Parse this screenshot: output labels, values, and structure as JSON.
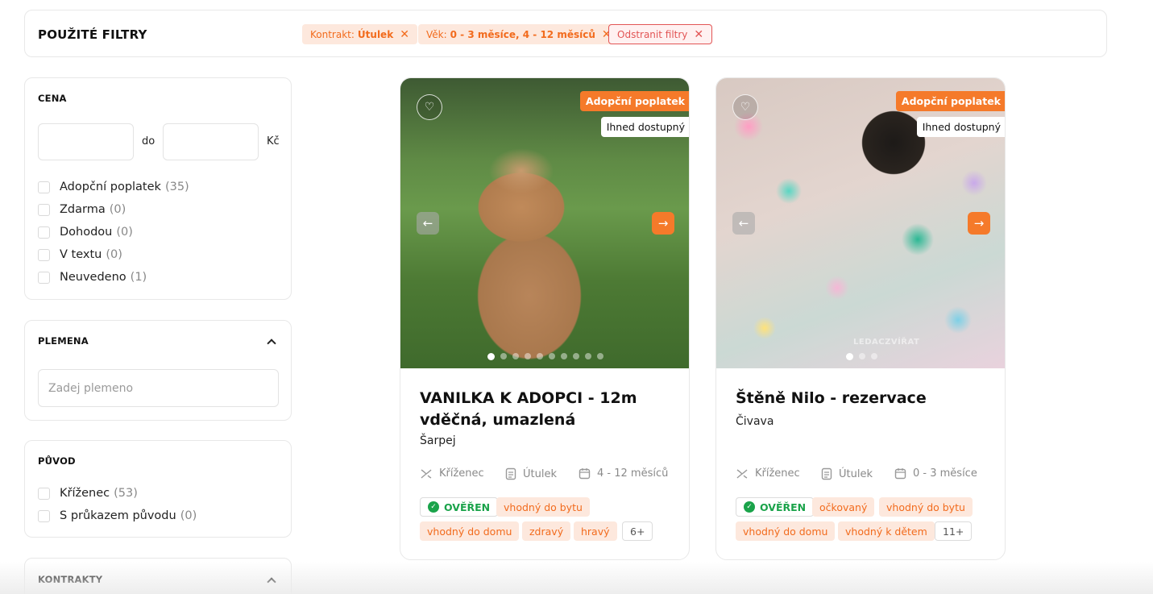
{
  "filters": {
    "title": "POUŽITÉ FILTRY",
    "chips": [
      {
        "label": "Kontrakt:",
        "value": "Útulek"
      },
      {
        "label": "Věk:",
        "value": "0 - 3 měsíce, 4 - 12 měsíců"
      }
    ],
    "clear_label": "Odstranit filtry"
  },
  "sidebar": {
    "price": {
      "title": "CENA",
      "separator": "do",
      "currency": "Kč",
      "options": [
        {
          "label": "Adopční poplatek",
          "count": "(35)"
        },
        {
          "label": "Zdarma",
          "count": "(0)"
        },
        {
          "label": "Dohodou",
          "count": "(0)"
        },
        {
          "label": "V textu",
          "count": "(0)"
        },
        {
          "label": "Neuvedeno",
          "count": "(1)"
        }
      ]
    },
    "breeds": {
      "title": "PLEMENA",
      "placeholder": "Zadej plemeno"
    },
    "origin": {
      "title": "PŮVOD",
      "options": [
        {
          "label": "Kříženec",
          "count": "(53)"
        },
        {
          "label": "S průkazem původu",
          "count": "(0)"
        }
      ]
    },
    "contracts": {
      "title": "KONTRAKTY"
    }
  },
  "cards": [
    {
      "badge_fee": "Adopční poplatek",
      "badge_available": "Ihned dostupný",
      "title": "VANILKA K ADOPCI - 12m vděčná, umazlená",
      "breed": "Šarpej",
      "meta": {
        "origin": "Kříženec",
        "contract": "Útulek",
        "age": "4 - 12 měsíců"
      },
      "verified": "OVĚŘEN",
      "tags": [
        "vhodný do bytu",
        "vhodný do domu",
        "zdravý",
        "hravý"
      ],
      "more": "6+"
    },
    {
      "badge_fee": "Adopční poplatek",
      "badge_available": "Ihned dostupný",
      "title": "Štěně Nilo - rezervace",
      "breed": "Čivava",
      "meta": {
        "origin": "Kříženec",
        "contract": "Útulek",
        "age": "0 - 3 měsíce"
      },
      "verified": "OVĚŘEN",
      "tags": [
        "očkovaný",
        "vhodný do bytu",
        "vhodný do domu",
        "vhodný k dětem"
      ],
      "more": "11+",
      "watermark": "LEDACZVÍŘAT"
    }
  ],
  "colors": {
    "accent": "#f57a2a",
    "accent_light": "#fde8dd",
    "verified": "#1aa34a",
    "danger": "#e25555"
  },
  "icons": [
    "close-icon",
    "chevron-up-icon",
    "heart-icon",
    "arrow-left-icon",
    "arrow-right-icon",
    "dna-icon",
    "document-icon",
    "calendar-icon",
    "check-circle-icon"
  ]
}
